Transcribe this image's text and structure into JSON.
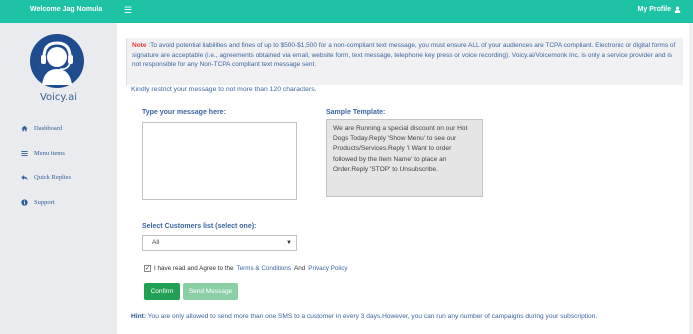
{
  "header": {
    "welcome": "Welcome Jag Nomula",
    "profile_label": "My Profile"
  },
  "sidebar": {
    "brand": "Voicy.ai",
    "items": [
      {
        "label": "Dashboard",
        "icon": "home-icon"
      },
      {
        "label": "Menu items",
        "icon": "list-icon"
      },
      {
        "label": "Quick Replies",
        "icon": "reply-icon"
      },
      {
        "label": "Support",
        "icon": "info-icon"
      }
    ]
  },
  "note": {
    "label": "Note",
    "text": ":To avoid potential liabilities and fines of up to $500-$1,500 for a non-compliant text message, you must ensure ALL of your audiences are TCPA compliant. Electronic or digital forms of signature are acceptable (i.e., agreements obtained via email, website form, text message, telephone key press or voice recording). Voicy.ai/Voicemonk Inc. is only a service provider and is not responsible for any Non-TCPA compliant text message sent."
  },
  "restrict_text": "Kindly restrict your message to not more than 120 characters.",
  "message": {
    "label": "Type your message here:",
    "value": ""
  },
  "template": {
    "label": "Sample Template:",
    "text": "We are Running a special discount on our Hot Dogs Today.Reply 'Show Menu' to see our Products/Services.Reply 'I Want to order followed by the Item Name' to place an Order.Reply 'STOP' to Unsubscribe."
  },
  "customers": {
    "label": "Select Customers list (select one):",
    "selected": "All"
  },
  "agree": {
    "checked": true,
    "prefix": "I have read and Agree to the",
    "terms": "Terms & Conditions",
    "and": "And",
    "privacy": "Privacy Policy"
  },
  "buttons": {
    "confirm": "Confirm",
    "send": "Send Message"
  },
  "hint": {
    "label": "Hint:",
    "text": "You are only allowed to send more than one SMS to a customer in every 3 days.However, you can run any number of campaigns during your subscription."
  },
  "colors": {
    "topbar": "#1ec3a5",
    "brand_blue": "#3b66a0",
    "confirm": "#22a055",
    "send": "#8bd0a5",
    "note_red": "#e33b3b"
  }
}
